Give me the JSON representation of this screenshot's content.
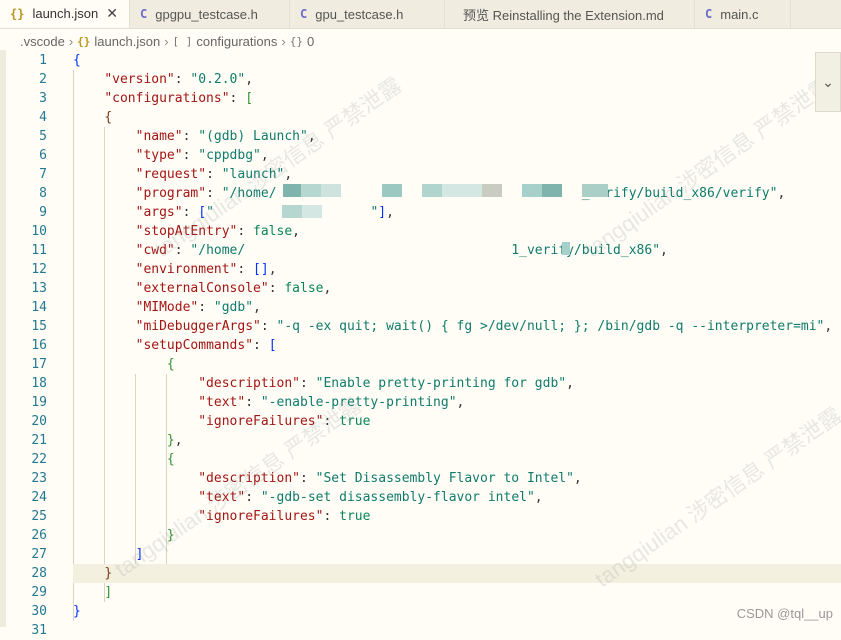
{
  "tabs": [
    {
      "icon": "{}",
      "label": "launch.json",
      "type": "json",
      "active": true
    },
    {
      "icon": "C",
      "label": "gpgpu_testcase.h",
      "type": "c"
    },
    {
      "icon": "C",
      "label": "gpu_testcase.h",
      "type": "c"
    },
    {
      "icon": "",
      "label": "预览 Reinstalling the Extension.md",
      "type": "md"
    },
    {
      "icon": "C",
      "label": "main.c",
      "type": "c"
    }
  ],
  "breadcrumb": {
    "folder": ".vscode",
    "file": "launch.json",
    "section": "configurations",
    "item": "0",
    "file_icon": "{}",
    "section_icon": "[ ]",
    "item_icon": "{}"
  },
  "lines": [
    {
      "n": "1",
      "html": "<span class='b1'>{</span>"
    },
    {
      "n": "2",
      "html": "    <span class='k'>\"version\"</span>: <span class='s'>\"0.2.0\"</span>,"
    },
    {
      "n": "3",
      "html": "    <span class='k'>\"configurations\"</span>: <span class='b2'>[</span>"
    },
    {
      "n": "4",
      "html": "    <span class='b3'>{</span>"
    },
    {
      "n": "5",
      "html": "        <span class='k'>\"name\"</span>: <span class='s'>\"(gdb) Launch\"</span>,"
    },
    {
      "n": "6",
      "html": "        <span class='k'>\"type\"</span>: <span class='s'>\"cppdbg\"</span>,"
    },
    {
      "n": "7",
      "html": "        <span class='k'>\"request\"</span>: <span class='s'>\"launch\"</span>,"
    },
    {
      "n": "8",
      "html": "        <span class='k'>\"program\"</span>: <span class='s'>\"/home/                                       _verify/build_x86/verify\"</span>,"
    },
    {
      "n": "9",
      "html": "        <span class='k'>\"args\"</span>: <span class='b1'>[</span><span class='s'>\"                    \"</span><span class='b1'>]</span>,"
    },
    {
      "n": "10",
      "html": "        <span class='k'>\"stopAtEntry\"</span>: <span class='n'>false</span>,"
    },
    {
      "n": "11",
      "html": "        <span class='k'>\"cwd\"</span>: <span class='s'>\"/home/                                  1_verify/build_x86\"</span>,"
    },
    {
      "n": "12",
      "html": "        <span class='k'>\"environment\"</span>: <span class='b1'>[]</span>,"
    },
    {
      "n": "13",
      "html": "        <span class='k'>\"externalConsole\"</span>: <span class='n'>false</span>,"
    },
    {
      "n": "14",
      "html": "        <span class='k'>\"MIMode\"</span>: <span class='s'>\"gdb\"</span>,"
    },
    {
      "n": "15",
      "html": "        <span class='k'>\"miDebuggerArgs\"</span>: <span class='s'>\"-q -ex quit; wait() { fg >/dev/null; }; /bin/gdb -q --interpreter=mi\"</span>,"
    },
    {
      "n": "16",
      "html": "        <span class='k'>\"setupCommands\"</span>: <span class='b1'>[</span>"
    },
    {
      "n": "17",
      "html": "            <span class='b2'>{</span>"
    },
    {
      "n": "18",
      "html": "                <span class='k'>\"description\"</span>: <span class='s'>\"Enable pretty-printing for gdb\"</span>,"
    },
    {
      "n": "19",
      "html": "                <span class='k'>\"text\"</span>: <span class='s'>\"-enable-pretty-printing\"</span>,"
    },
    {
      "n": "20",
      "html": "                <span class='k'>\"ignoreFailures\"</span>: <span class='n'>true</span>"
    },
    {
      "n": "21",
      "html": "            <span class='b2'>}</span>,"
    },
    {
      "n": "22",
      "html": "            <span class='b2'>{</span>"
    },
    {
      "n": "23",
      "html": "                <span class='k'>\"description\"</span>: <span class='s'>\"Set Disassembly Flavor to Intel\"</span>,"
    },
    {
      "n": "24",
      "html": "                <span class='k'>\"text\"</span>: <span class='s'>\"-gdb-set disassembly-flavor intel\"</span>,"
    },
    {
      "n": "25",
      "html": "                <span class='k'>\"ignoreFailures\"</span>: <span class='n'>true</span>"
    },
    {
      "n": "26",
      "html": "            <span class='b2'>}</span>"
    },
    {
      "n": "27",
      "html": "        <span class='b1'>]</span>"
    },
    {
      "n": "28",
      "html": "    <span class='b3'>}</span>",
      "current": true
    },
    {
      "n": "29",
      "html": "    <span class='b2'>]</span>"
    },
    {
      "n": "30",
      "html": "<span class='b1'>}</span>"
    },
    {
      "n": "31",
      "html": ""
    }
  ],
  "watermark_text": "tangqiulian 涉密信息 严禁泄露",
  "credit": "CSDN @tql__up"
}
